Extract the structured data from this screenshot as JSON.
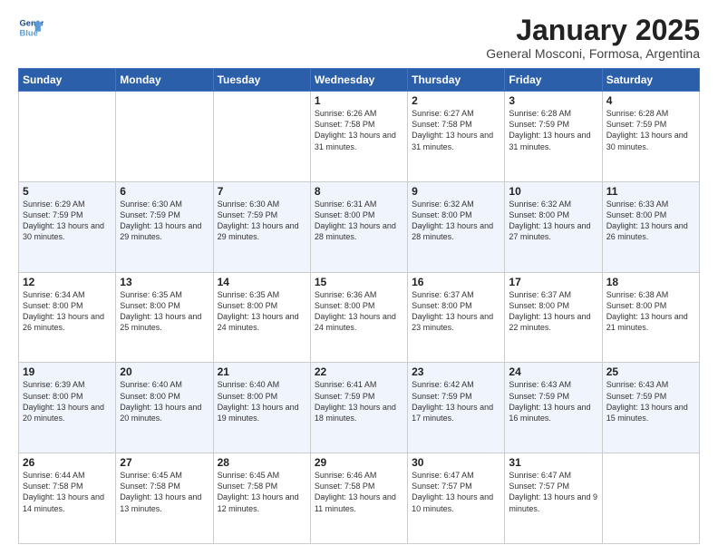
{
  "logo": {
    "line1": "General",
    "line2": "Blue"
  },
  "title": "January 2025",
  "subtitle": "General Mosconi, Formosa, Argentina",
  "days_of_week": [
    "Sunday",
    "Monday",
    "Tuesday",
    "Wednesday",
    "Thursday",
    "Friday",
    "Saturday"
  ],
  "weeks": [
    [
      {
        "day": "",
        "info": ""
      },
      {
        "day": "",
        "info": ""
      },
      {
        "day": "",
        "info": ""
      },
      {
        "day": "1",
        "info": "Sunrise: 6:26 AM\nSunset: 7:58 PM\nDaylight: 13 hours\nand 31 minutes."
      },
      {
        "day": "2",
        "info": "Sunrise: 6:27 AM\nSunset: 7:58 PM\nDaylight: 13 hours\nand 31 minutes."
      },
      {
        "day": "3",
        "info": "Sunrise: 6:28 AM\nSunset: 7:59 PM\nDaylight: 13 hours\nand 31 minutes."
      },
      {
        "day": "4",
        "info": "Sunrise: 6:28 AM\nSunset: 7:59 PM\nDaylight: 13 hours\nand 30 minutes."
      }
    ],
    [
      {
        "day": "5",
        "info": "Sunrise: 6:29 AM\nSunset: 7:59 PM\nDaylight: 13 hours\nand 30 minutes."
      },
      {
        "day": "6",
        "info": "Sunrise: 6:30 AM\nSunset: 7:59 PM\nDaylight: 13 hours\nand 29 minutes."
      },
      {
        "day": "7",
        "info": "Sunrise: 6:30 AM\nSunset: 7:59 PM\nDaylight: 13 hours\nand 29 minutes."
      },
      {
        "day": "8",
        "info": "Sunrise: 6:31 AM\nSunset: 8:00 PM\nDaylight: 13 hours\nand 28 minutes."
      },
      {
        "day": "9",
        "info": "Sunrise: 6:32 AM\nSunset: 8:00 PM\nDaylight: 13 hours\nand 28 minutes."
      },
      {
        "day": "10",
        "info": "Sunrise: 6:32 AM\nSunset: 8:00 PM\nDaylight: 13 hours\nand 27 minutes."
      },
      {
        "day": "11",
        "info": "Sunrise: 6:33 AM\nSunset: 8:00 PM\nDaylight: 13 hours\nand 26 minutes."
      }
    ],
    [
      {
        "day": "12",
        "info": "Sunrise: 6:34 AM\nSunset: 8:00 PM\nDaylight: 13 hours\nand 26 minutes."
      },
      {
        "day": "13",
        "info": "Sunrise: 6:35 AM\nSunset: 8:00 PM\nDaylight: 13 hours\nand 25 minutes."
      },
      {
        "day": "14",
        "info": "Sunrise: 6:35 AM\nSunset: 8:00 PM\nDaylight: 13 hours\nand 24 minutes."
      },
      {
        "day": "15",
        "info": "Sunrise: 6:36 AM\nSunset: 8:00 PM\nDaylight: 13 hours\nand 24 minutes."
      },
      {
        "day": "16",
        "info": "Sunrise: 6:37 AM\nSunset: 8:00 PM\nDaylight: 13 hours\nand 23 minutes."
      },
      {
        "day": "17",
        "info": "Sunrise: 6:37 AM\nSunset: 8:00 PM\nDaylight: 13 hours\nand 22 minutes."
      },
      {
        "day": "18",
        "info": "Sunrise: 6:38 AM\nSunset: 8:00 PM\nDaylight: 13 hours\nand 21 minutes."
      }
    ],
    [
      {
        "day": "19",
        "info": "Sunrise: 6:39 AM\nSunset: 8:00 PM\nDaylight: 13 hours\nand 20 minutes."
      },
      {
        "day": "20",
        "info": "Sunrise: 6:40 AM\nSunset: 8:00 PM\nDaylight: 13 hours\nand 20 minutes."
      },
      {
        "day": "21",
        "info": "Sunrise: 6:40 AM\nSunset: 8:00 PM\nDaylight: 13 hours\nand 19 minutes."
      },
      {
        "day": "22",
        "info": "Sunrise: 6:41 AM\nSunset: 7:59 PM\nDaylight: 13 hours\nand 18 minutes."
      },
      {
        "day": "23",
        "info": "Sunrise: 6:42 AM\nSunset: 7:59 PM\nDaylight: 13 hours\nand 17 minutes."
      },
      {
        "day": "24",
        "info": "Sunrise: 6:43 AM\nSunset: 7:59 PM\nDaylight: 13 hours\nand 16 minutes."
      },
      {
        "day": "25",
        "info": "Sunrise: 6:43 AM\nSunset: 7:59 PM\nDaylight: 13 hours\nand 15 minutes."
      }
    ],
    [
      {
        "day": "26",
        "info": "Sunrise: 6:44 AM\nSunset: 7:58 PM\nDaylight: 13 hours\nand 14 minutes."
      },
      {
        "day": "27",
        "info": "Sunrise: 6:45 AM\nSunset: 7:58 PM\nDaylight: 13 hours\nand 13 minutes."
      },
      {
        "day": "28",
        "info": "Sunrise: 6:45 AM\nSunset: 7:58 PM\nDaylight: 13 hours\nand 12 minutes."
      },
      {
        "day": "29",
        "info": "Sunrise: 6:46 AM\nSunset: 7:58 PM\nDaylight: 13 hours\nand 11 minutes."
      },
      {
        "day": "30",
        "info": "Sunrise: 6:47 AM\nSunset: 7:57 PM\nDaylight: 13 hours\nand 10 minutes."
      },
      {
        "day": "31",
        "info": "Sunrise: 6:47 AM\nSunset: 7:57 PM\nDaylight: 13 hours\nand 9 minutes."
      },
      {
        "day": "",
        "info": ""
      }
    ]
  ]
}
